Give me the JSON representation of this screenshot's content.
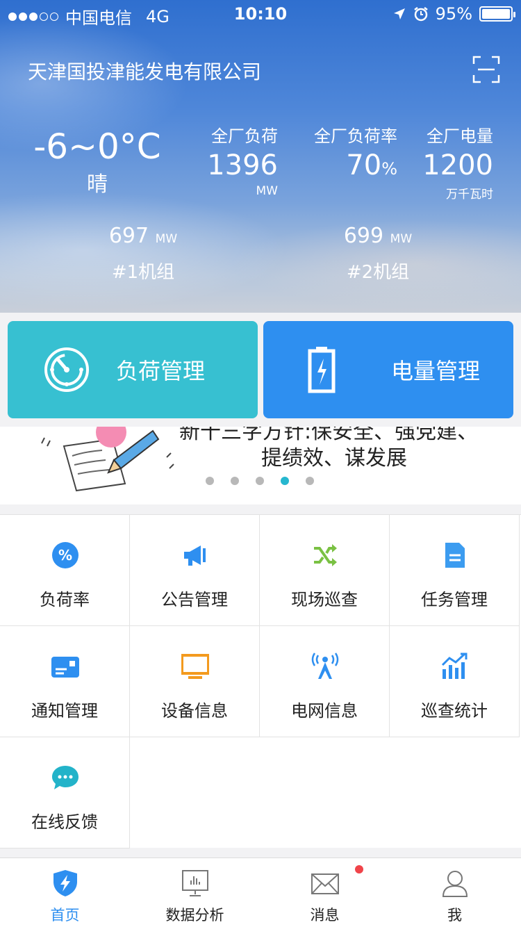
{
  "status_bar": {
    "carrier": "中国电信",
    "network": "4G",
    "time": "10:10",
    "battery": "95%"
  },
  "header": {
    "company": "天津国投津能发电有限公司",
    "weather": {
      "temp": "-6~0°C",
      "condition": "晴"
    },
    "stats": [
      {
        "label": "全厂负荷",
        "value": "1396",
        "unit": "MW"
      },
      {
        "label": "全厂负荷率",
        "value": "70",
        "pct": "%"
      },
      {
        "label": "全厂电量",
        "value": "1200",
        "unit": "万千瓦时"
      }
    ],
    "units": [
      {
        "value": "697",
        "unit": "MW",
        "name": "#1机组"
      },
      {
        "value": "699",
        "unit": "MW",
        "name": "#2机组"
      }
    ]
  },
  "actions": {
    "load_mgmt": "负荷管理",
    "power_mgmt": "电量管理"
  },
  "banner": {
    "line1": "新十三字方针:保安全、强党建、",
    "line2": "提绩效、谋发展",
    "pages": 5,
    "active_page": 4
  },
  "grid": {
    "items": [
      {
        "label": "负荷率",
        "icon": "percent-icon",
        "color": "#2e8ff0"
      },
      {
        "label": "公告管理",
        "icon": "megaphone-icon",
        "color": "#2e8ff0"
      },
      {
        "label": "现场巡查",
        "icon": "shuffle-icon",
        "color": "#7ac143"
      },
      {
        "label": "任务管理",
        "icon": "document-icon",
        "color": "#3c9cf0"
      },
      {
        "label": "通知管理",
        "icon": "card-icon",
        "color": "#2e8ff0"
      },
      {
        "label": "设备信息",
        "icon": "monitor-icon",
        "color": "#f39a1e"
      },
      {
        "label": "电网信息",
        "icon": "tower-icon",
        "color": "#2e8ff0"
      },
      {
        "label": "巡查统计",
        "icon": "chart-icon",
        "color": "#2e8ff0"
      },
      {
        "label": "在线反馈",
        "icon": "chat-icon",
        "color": "#23b3c9"
      }
    ]
  },
  "tabbar": {
    "tabs": [
      {
        "label": "首页",
        "icon": "shield-bolt-icon",
        "active": true
      },
      {
        "label": "数据分析",
        "icon": "analytics-board-icon"
      },
      {
        "label": "消息",
        "icon": "envelope-icon"
      },
      {
        "label": "我",
        "icon": "user-icon"
      }
    ]
  }
}
